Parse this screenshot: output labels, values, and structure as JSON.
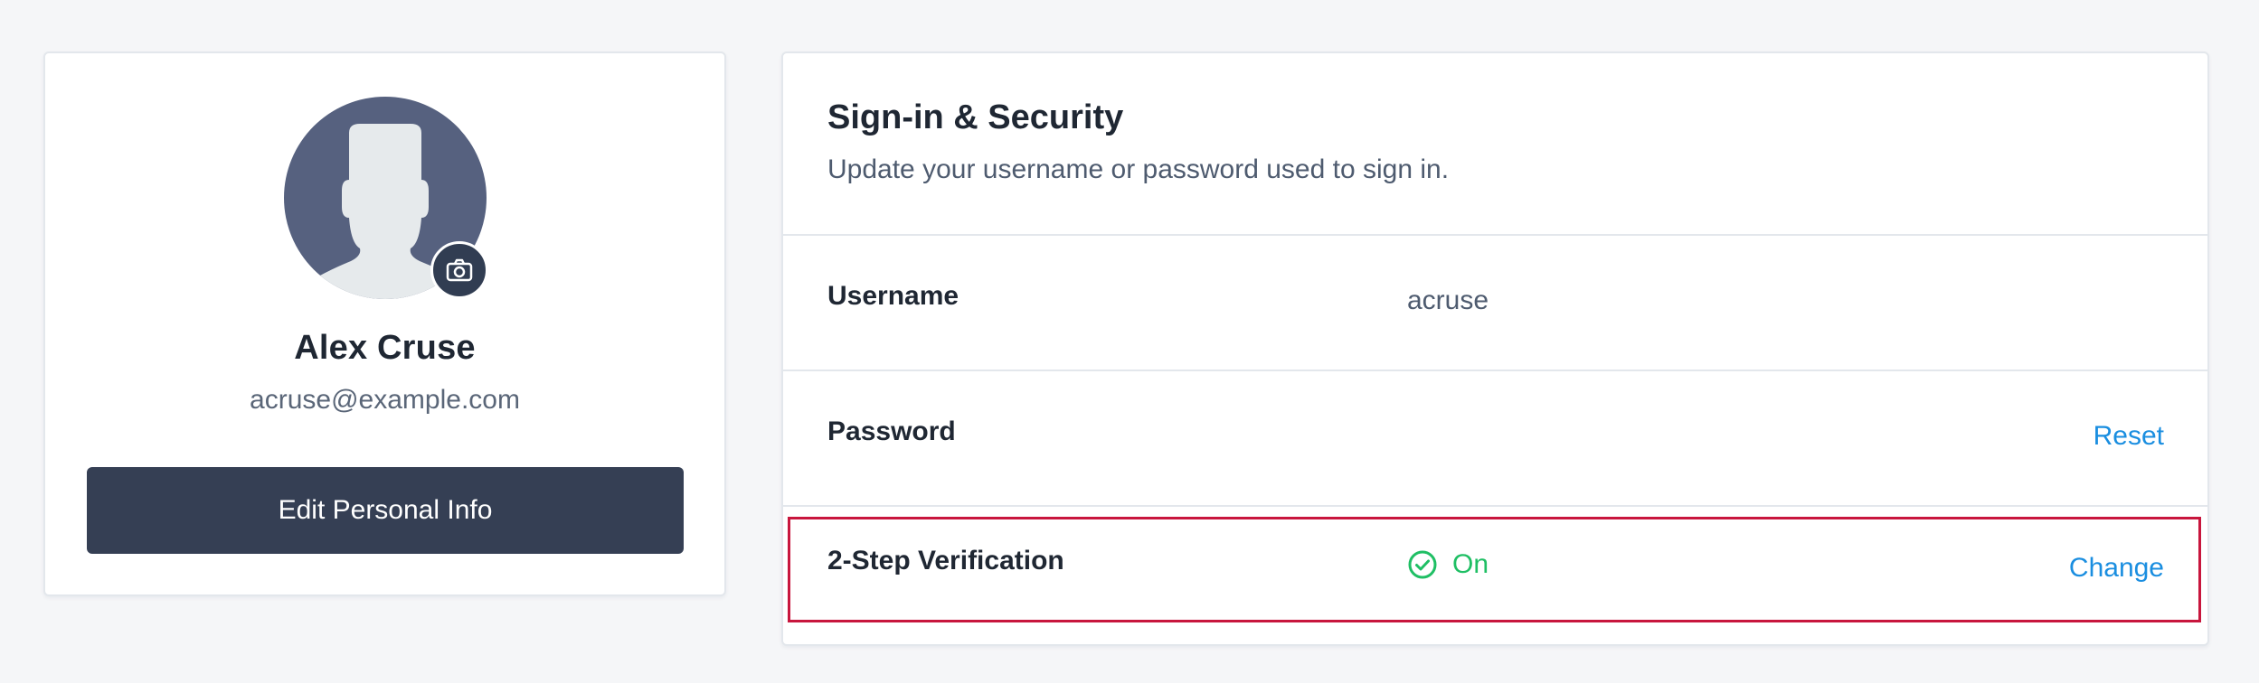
{
  "profile": {
    "name": "Alex Cruse",
    "email": "acruse@example.com",
    "edit_button_label": "Edit Personal Info",
    "avatar_icon": "default-user-silhouette",
    "camera_icon": "camera-icon"
  },
  "security": {
    "title": "Sign-in & Security",
    "subtitle": "Update your username or password used to sign in.",
    "rows": [
      {
        "label": "Username",
        "value": "acruse",
        "action": ""
      },
      {
        "label": "Password",
        "value": "",
        "action": "Reset"
      },
      {
        "label": "2-Step Verification",
        "status": "On",
        "status_icon": "check-circle-icon",
        "action": "Change"
      }
    ]
  },
  "colors": {
    "page_background": "#f5f6f8",
    "primary_button": "#353f54",
    "link": "#1a8ee0",
    "status_on": "#1fbf64",
    "highlight": "#c8163d",
    "avatar_background": "#56617f"
  }
}
